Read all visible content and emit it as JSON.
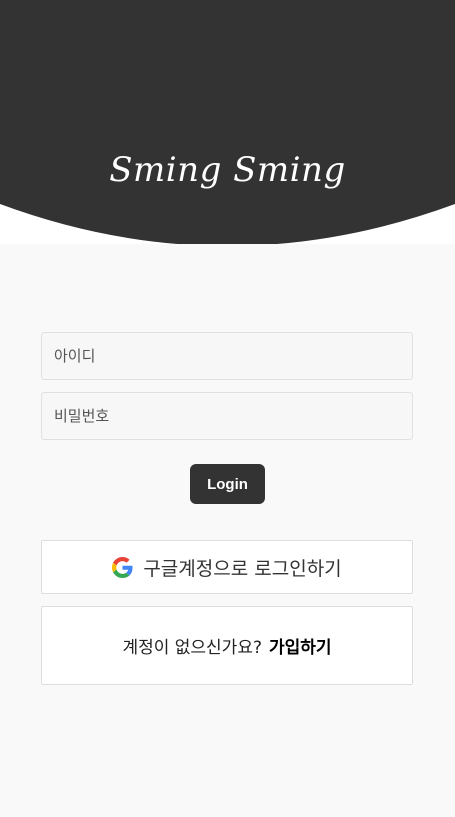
{
  "header": {
    "logo_text": "Sming Sming",
    "background_color": "#333333"
  },
  "form": {
    "id_placeholder": "아이디",
    "id_value": "",
    "password_placeholder": "비밀번호",
    "password_value": "",
    "login_label": "Login"
  },
  "social": {
    "google_label": "구글계정으로 로그인하기",
    "google_icon": "google-g-icon"
  },
  "signup": {
    "prompt": "계정이 없으신가요?",
    "link_label": "가입하기"
  }
}
